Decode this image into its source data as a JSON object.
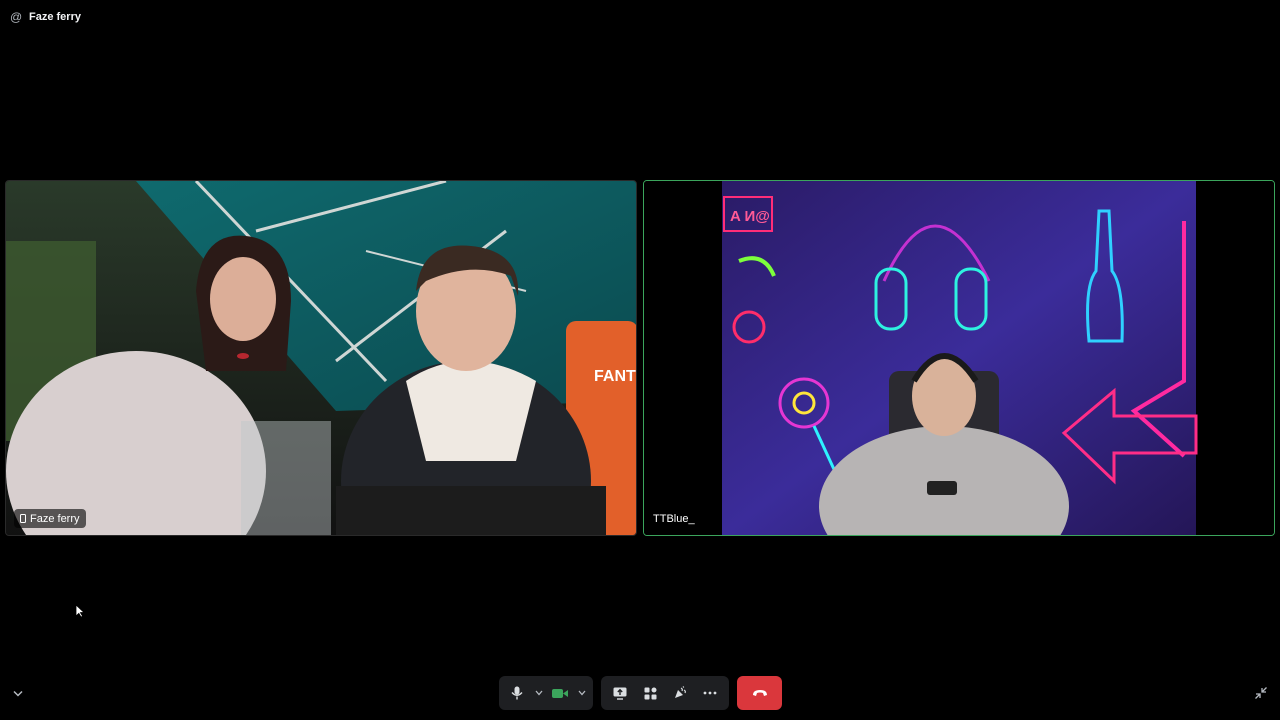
{
  "header": {
    "channel_icon": "at-sign-icon",
    "title": "Faze ferry"
  },
  "tiles": [
    {
      "name": "Faze ferry",
      "device_icon": "phone-icon",
      "speaking": false
    },
    {
      "name": "TTBlue_",
      "speaking": true
    }
  ],
  "controls": {
    "microphone": "microphone-icon",
    "camera": "camera-icon",
    "screen_share": "screen-share-icon",
    "activities": "activities-icon",
    "soundboard": "soundboard-icon",
    "more": "more-icon",
    "disconnect": "hang-up-icon"
  },
  "colors": {
    "speaking_border": "#3ba55c",
    "disconnect": "#da373c",
    "camera_on": "#3ba55c",
    "control_bg": "#1e1f22"
  }
}
